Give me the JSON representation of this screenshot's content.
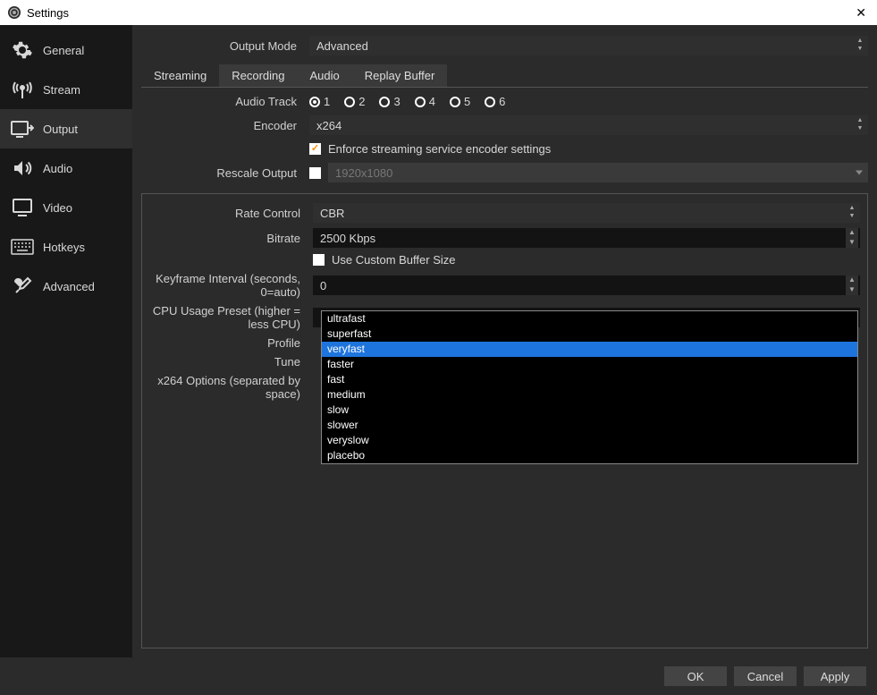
{
  "window": {
    "title": "Settings"
  },
  "sidebar": {
    "items": [
      {
        "label": "General"
      },
      {
        "label": "Stream"
      },
      {
        "label": "Output"
      },
      {
        "label": "Audio"
      },
      {
        "label": "Video"
      },
      {
        "label": "Hotkeys"
      },
      {
        "label": "Advanced"
      }
    ]
  },
  "top": {
    "output_mode_label": "Output Mode",
    "output_mode_value": "Advanced"
  },
  "tabs": [
    "Streaming",
    "Recording",
    "Audio",
    "Replay Buffer"
  ],
  "fields": {
    "audio_track_label": "Audio Track",
    "tracks": [
      "1",
      "2",
      "3",
      "4",
      "5",
      "6"
    ],
    "encoder_label": "Encoder",
    "encoder_value": "x264",
    "enforce_label": "Enforce streaming service encoder settings",
    "rescale_label": "Rescale Output",
    "rescale_value": "1920x1080",
    "rate_control_label": "Rate Control",
    "rate_control_value": "CBR",
    "bitrate_label": "Bitrate",
    "bitrate_value": "2500 Kbps",
    "custom_buffer_label": "Use Custom Buffer Size",
    "keyframe_label": "Keyframe Interval (seconds, 0=auto)",
    "keyframe_value": "0",
    "cpu_preset_label": "CPU Usage Preset (higher = less CPU)",
    "cpu_preset_value": "veryfast",
    "profile_label": "Profile",
    "tune_label": "Tune",
    "x264_opts_label": "x264 Options (separated by space)"
  },
  "dropdown_options": [
    "ultrafast",
    "superfast",
    "veryfast",
    "faster",
    "fast",
    "medium",
    "slow",
    "slower",
    "veryslow",
    "placebo"
  ],
  "buttons": {
    "ok": "OK",
    "cancel": "Cancel",
    "apply": "Apply"
  }
}
